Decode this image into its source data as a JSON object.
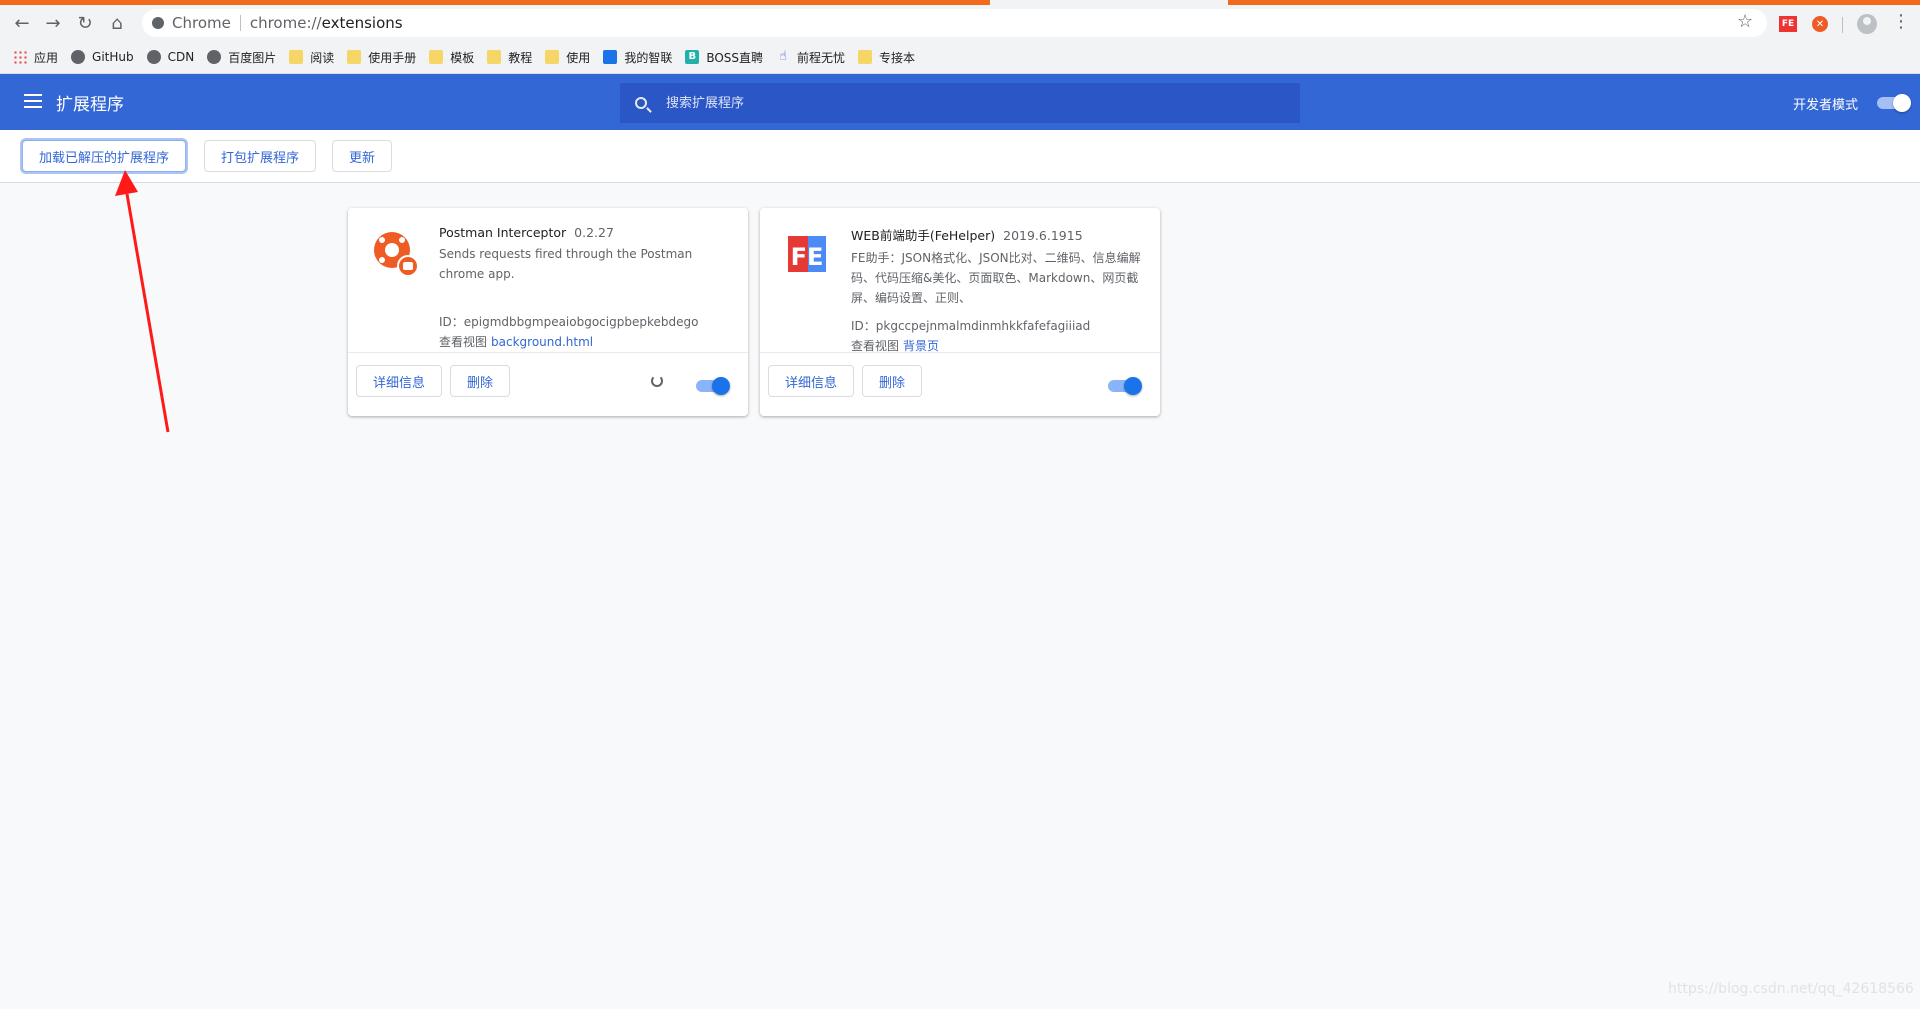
{
  "browser": {
    "chip_label": "Chrome",
    "url_scheme": "chrome://",
    "url_host": "extensions",
    "nav": {
      "back_icon": "←",
      "forward_icon": "→",
      "reload_icon": "↻",
      "home_icon": "⌂"
    },
    "star_icon": "☆",
    "menu_icon": "⋮",
    "extension_badges": {
      "fehelper": "FE",
      "postman": "✕"
    }
  },
  "bookmarks": [
    {
      "label": "应用",
      "icon": "apps"
    },
    {
      "label": "GitHub",
      "icon": "globe"
    },
    {
      "label": "CDN",
      "icon": "globe"
    },
    {
      "label": "百度图片",
      "icon": "globe"
    },
    {
      "label": "阅读",
      "icon": "folder"
    },
    {
      "label": "使用手册",
      "icon": "folder"
    },
    {
      "label": "模板",
      "icon": "folder"
    },
    {
      "label": "教程",
      "icon": "folder"
    },
    {
      "label": "使用",
      "icon": "folder"
    },
    {
      "label": "我的智联",
      "icon": "blue-square"
    },
    {
      "label": "BOSS直聘",
      "icon": "teal-b",
      "icon_text": "B"
    },
    {
      "label": "前程无忧",
      "icon": "hand",
      "icon_text": "☝"
    },
    {
      "label": "专接本",
      "icon": "folder"
    }
  ],
  "header": {
    "title": "扩展程序",
    "search_placeholder": "搜索扩展程序",
    "dev_mode_label": "开发者模式",
    "dev_mode_on": true
  },
  "actions": {
    "load_unpacked": "加载已解压的扩展程序",
    "pack": "打包扩展程序",
    "update": "更新"
  },
  "extensions": [
    {
      "name": "Postman Interceptor",
      "version": "0.2.27",
      "description": "Sends requests fired through the Postman chrome app.",
      "id_line": "ID：epigmdbbgmpeaiobgocigpbepkebdego",
      "views_label": "查看视图",
      "view_link": "background.html",
      "details_label": "详细信息",
      "remove_label": "删除",
      "enabled": true,
      "icon": "postman-icon"
    },
    {
      "name": "WEB前端助手(FeHelper)",
      "version": "2019.6.1915",
      "description": "FE助手：JSON格式化、JSON比对、二维码、信息编解码、代码压缩&美化、页面取色、Markdown、网页截屏、编码设置、正则、",
      "id_line": "ID：pkgccpejnmalmdinmhkkfafefagiiiad",
      "views_label": "查看视图",
      "view_link": "背景页",
      "details_label": "详细信息",
      "remove_label": "删除",
      "enabled": true,
      "icon": "fehelper-icon",
      "icon_text": "FE"
    }
  ],
  "colors": {
    "header_blue": "#3367d6",
    "search_blue": "#2a56c6",
    "tab_stripe_orange": "#f26b1d",
    "annotation_red": "#ff1a1a",
    "toggle_blue": "#1a73e8"
  },
  "watermark": "https://blog.csdn.net/qq_42618566"
}
